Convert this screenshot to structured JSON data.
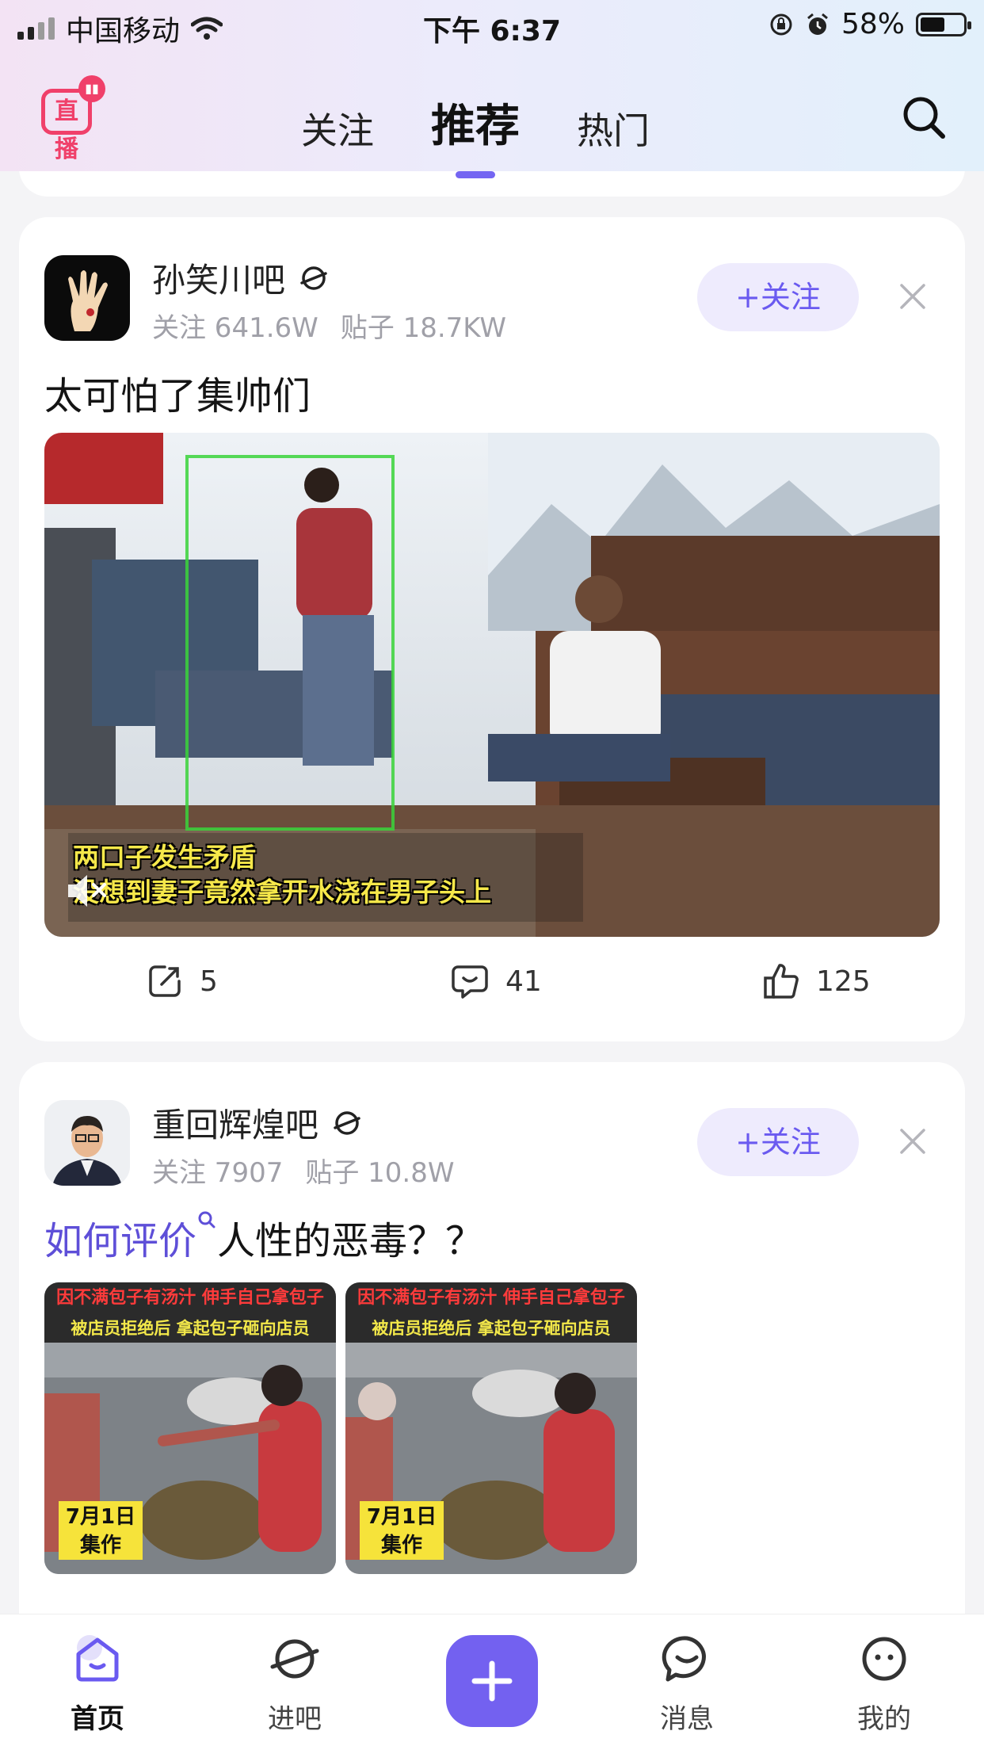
{
  "status_bar": {
    "carrier": "中国移动",
    "time": "下午 6:37",
    "battery": "58%",
    "battery_level": 0.58
  },
  "header": {
    "live_label": "直播",
    "tabs": [
      {
        "label": "关注",
        "active": false
      },
      {
        "label": "推荐",
        "active": true
      },
      {
        "label": "热门",
        "active": false
      }
    ]
  },
  "posts": [
    {
      "forum": "孙笑川吧",
      "followers_label": "关注 641.6W",
      "posts_label": "贴子 18.7KW",
      "follow_label": "+关注",
      "title": "太可怕了集帅们",
      "video_caption_line1": "两口子发生矛盾",
      "video_caption_line2": "没想到妻子竟然拿开水浇在男子头上",
      "share_count": "5",
      "comment_count": "41",
      "like_count": "125"
    },
    {
      "forum": "重回辉煌吧",
      "followers_label": "关注 7907",
      "posts_label": "贴子 10.8W",
      "follow_label": "+关注",
      "title_highlight": "如何评价",
      "title_rest": "人性的恶毒？？",
      "thumb_banner_line1": "因不满包子有汤汁 伸手自己拿包子",
      "thumb_banner_line2": "被店员拒绝后 拿起包子砸向店员",
      "thumb_date": "7月1日",
      "thumb_tag": "集作"
    }
  ],
  "bottom_nav": [
    {
      "label": "首页",
      "icon": "home-icon",
      "active": true
    },
    {
      "label": "进吧",
      "icon": "planet-icon",
      "active": false
    },
    {
      "label": "",
      "icon": "plus-icon",
      "active": false
    },
    {
      "label": "消息",
      "icon": "message-icon",
      "active": false
    },
    {
      "label": "我的",
      "icon": "profile-icon",
      "active": false
    }
  ],
  "colors": {
    "accent": "#7361f0",
    "live": "#f0406a",
    "meta_gray": "#a0a0a8"
  }
}
